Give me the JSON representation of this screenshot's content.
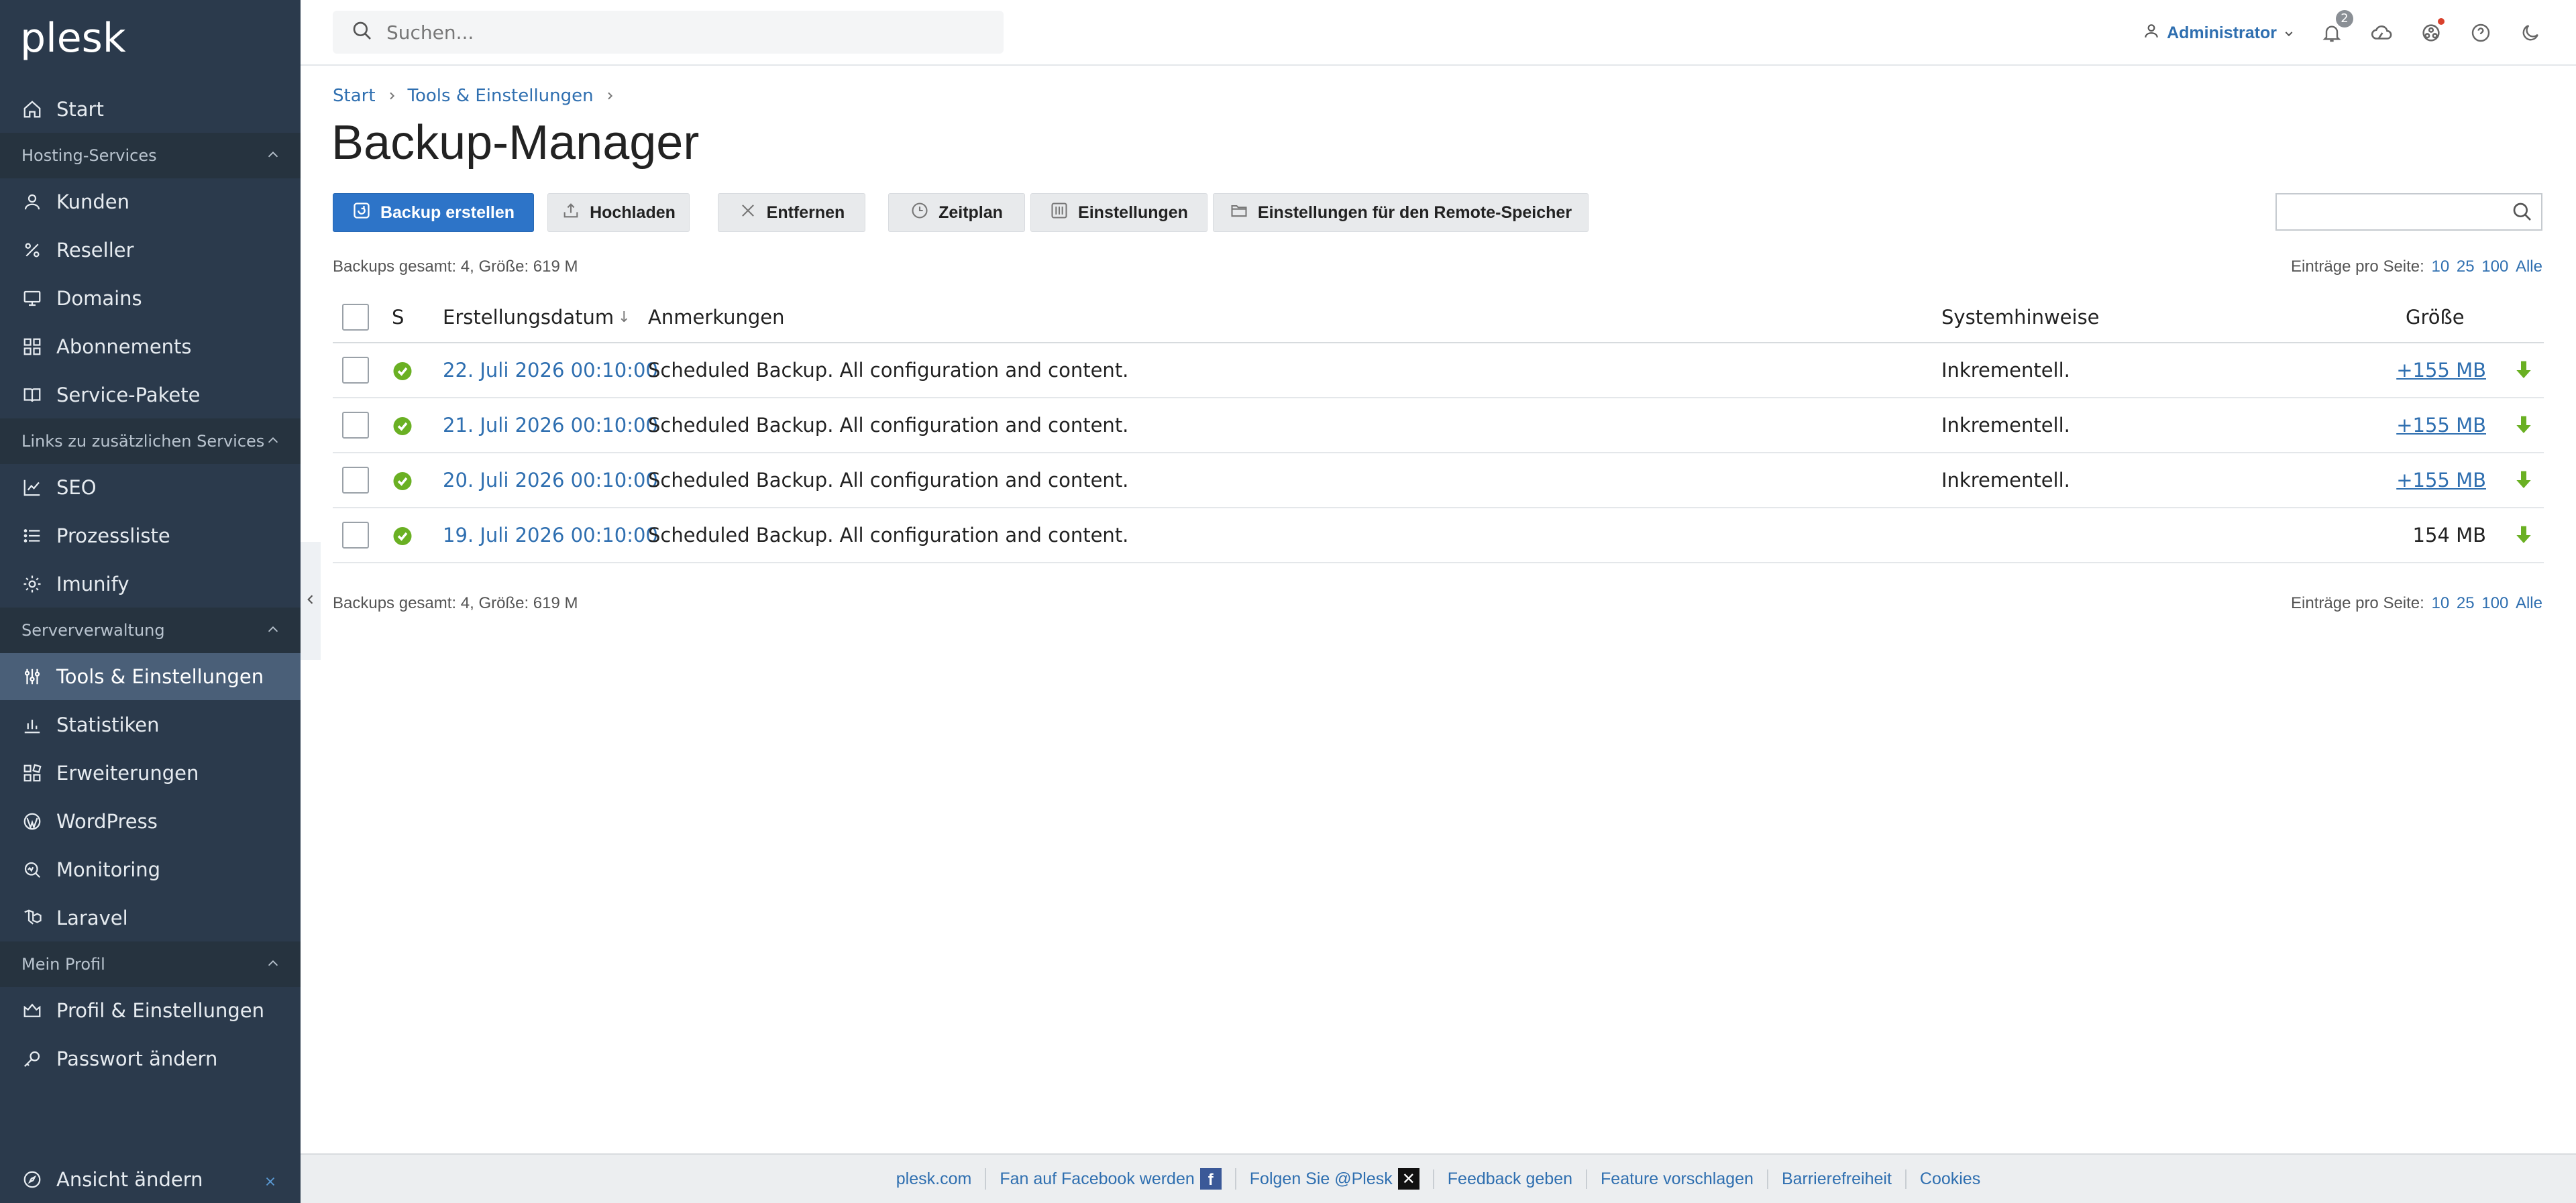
{
  "logo": "plesk",
  "search": {
    "placeholder": "Suchen..."
  },
  "header": {
    "user": "Administrator",
    "notifications_count": "2"
  },
  "sidebar": {
    "start": "Start",
    "sections": [
      {
        "label": "Hosting-Services",
        "items": [
          "Kunden",
          "Reseller",
          "Domains",
          "Abonnements",
          "Service-Pakete"
        ]
      },
      {
        "label": "Links zu zusätzlichen Services",
        "items": [
          "SEO",
          "Prozessliste",
          "Imunify"
        ]
      },
      {
        "label": "Serververwaltung",
        "items": [
          "Tools & Einstellungen",
          "Statistiken",
          "Erweiterungen",
          "WordPress",
          "Monitoring",
          "Laravel"
        ]
      },
      {
        "label": "Mein Profil",
        "items": [
          "Profil & Einstellungen",
          "Passwort ändern"
        ]
      }
    ],
    "view_change": "Ansicht ändern"
  },
  "breadcrumb": [
    "Start",
    "Tools & Einstellungen"
  ],
  "page_title": "Backup-Manager",
  "toolbar": {
    "create": "Backup erstellen",
    "upload": "Hochladen",
    "remove": "Entfernen",
    "schedule": "Zeitplan",
    "settings": "Einstellungen",
    "remote": "Einstellungen für den Remote-Speicher"
  },
  "summary": "Backups gesamt: 4, Größe: 619 M",
  "per_page": {
    "label": "Einträge pro Seite:",
    "opt10": "10",
    "opt25": "25",
    "opt100": "100",
    "all": "Alle"
  },
  "table": {
    "headers": {
      "status": "S",
      "date": "Erstellungsdatum",
      "sort": "↓",
      "notes": "Anmerkungen",
      "system": "Systemhinweise",
      "size": "Größe"
    },
    "rows": [
      {
        "date": "22. Juli 2026 00:10:00",
        "notes": "Scheduled Backup. All configuration and content.",
        "system": "Inkrementell.",
        "size": "+155 MB"
      },
      {
        "date": "21. Juli 2026 00:10:00",
        "notes": "Scheduled Backup. All configuration and content.",
        "system": "Inkrementell.",
        "size": "+155 MB"
      },
      {
        "date": "20. Juli 2026 00:10:00",
        "notes": "Scheduled Backup. All configuration and content.",
        "system": "Inkrementell.",
        "size": "+155 MB"
      },
      {
        "date": "19. Juli 2026 00:10:00",
        "notes": "Scheduled Backup. All configuration and content.",
        "system": "",
        "size": "154 MB"
      }
    ]
  },
  "footer": [
    "plesk.com",
    "Fan auf Facebook werden",
    "Folgen Sie @Plesk",
    "Feedback geben",
    "Feature vorschlagen",
    "Barrierefreiheit",
    "Cookies"
  ],
  "colors": {
    "sidebar": "#2b3a4c",
    "accent": "#2d74c8",
    "link": "#2f6fb0",
    "success": "#6ab023"
  }
}
